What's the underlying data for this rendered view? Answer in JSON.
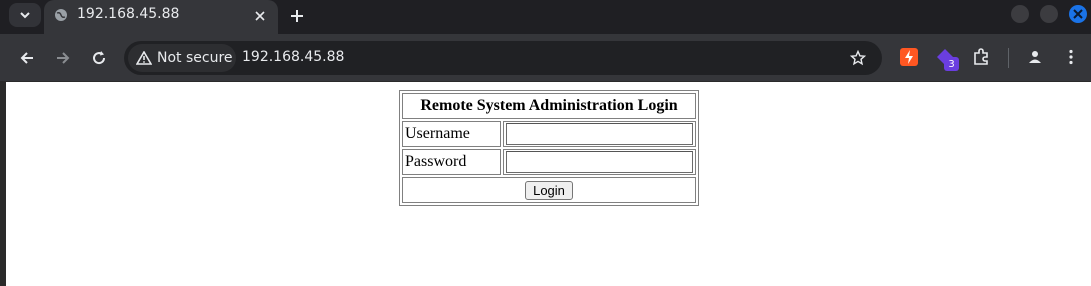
{
  "browser": {
    "tab": {
      "title": "192.168.45.88"
    },
    "omnibox": {
      "security_label": "Not secure",
      "url": "192.168.45.88"
    },
    "extension_badge_count": "3",
    "colors": {
      "accent": "#1a73e8",
      "extension_orange": "#ff5722",
      "extension_purple": "#6a3ee0"
    }
  },
  "login_form": {
    "title": "Remote System Administration Login",
    "username_label": "Username",
    "username_value": "",
    "password_label": "Password",
    "password_value": "",
    "submit_label": "Login"
  }
}
